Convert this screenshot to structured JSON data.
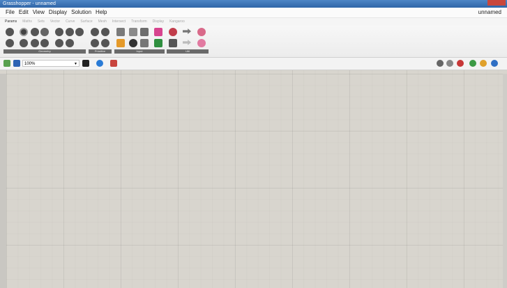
{
  "window": {
    "title": "Grasshopper - unnamed",
    "doc_name": "unnamed"
  },
  "menu": [
    "File",
    "Edit",
    "View",
    "Display",
    "Solution",
    "Help"
  ],
  "tabs": [
    "Params",
    "Maths",
    "Sets",
    "Vector",
    "Curve",
    "Surface",
    "Mesh",
    "Intersect",
    "Transform",
    "Display",
    "Kangaroo"
  ],
  "ribbon_groups": [
    "Geometry",
    "Primitive",
    "Input",
    "Util"
  ],
  "toolbar": {
    "zoom": "100%"
  },
  "colors": {
    "canvas": "#d8d5ce",
    "accent": "#2f66a8"
  }
}
